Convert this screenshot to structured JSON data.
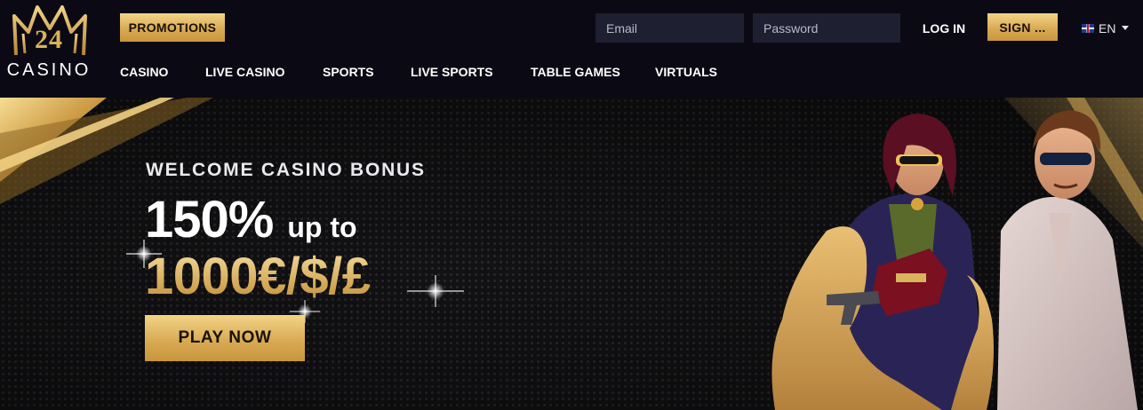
{
  "brand": {
    "number": "24",
    "word": "CASINO"
  },
  "header": {
    "promotions_label": "PROMOTIONS",
    "email_placeholder": "Email",
    "password_placeholder": "Password",
    "login_label": "LOG IN",
    "signup_label": "SIGN ...",
    "language": "EN"
  },
  "nav": {
    "items": [
      {
        "label": "CASINO"
      },
      {
        "label": "LIVE CASINO"
      },
      {
        "label": "SPORTS"
      },
      {
        "label": "LIVE SPORTS"
      },
      {
        "label": "TABLE GAMES"
      },
      {
        "label": "VIRTUALS"
      }
    ]
  },
  "hero": {
    "kicker": "WELCOME CASINO BONUS",
    "percent": "150%",
    "upto": "up to",
    "amount": "1000€/$/£",
    "cta_label": "PLAY NOW"
  },
  "colors": {
    "background": "#0b0a14",
    "accent_gold": "#d9ab55",
    "input_bg": "#1e1f30"
  },
  "icons": [
    "crown-logo-icon",
    "uk-flag-icon",
    "chevron-down-icon",
    "sparkle-icon"
  ]
}
